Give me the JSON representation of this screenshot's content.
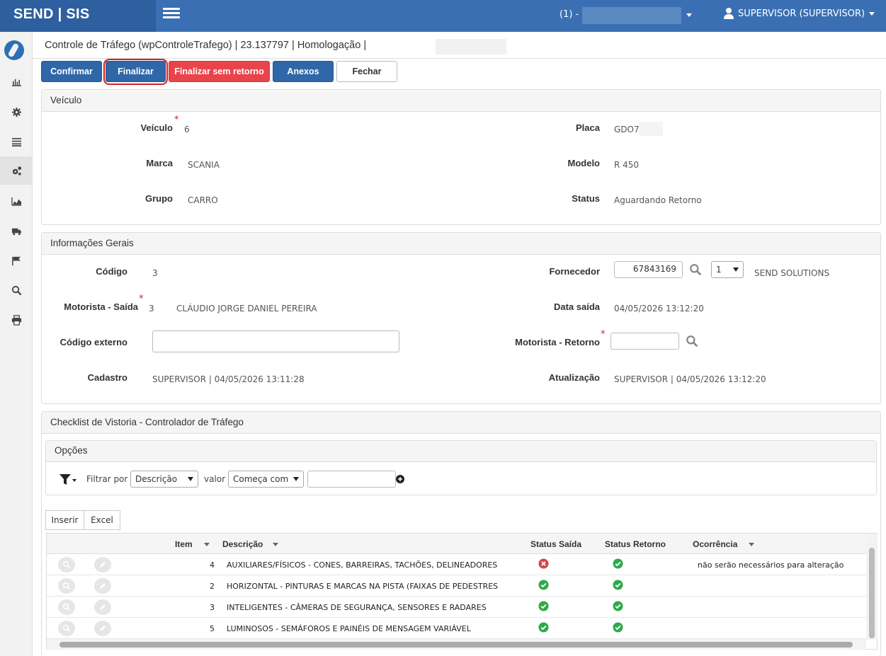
{
  "app": {
    "brand": "SEND | SIS",
    "session": "(1) -",
    "user": "SUPERVISOR (SUPERVISOR)"
  },
  "page": {
    "title": "Controle de Tráfego (wpControleTrafego) | 23.137797 | Homologação |"
  },
  "toolbar": {
    "confirmar": "Confirmar",
    "finalizar": "Finalizar",
    "finalizar_sem_retorno": "Finalizar sem retorno",
    "anexos": "Anexos",
    "fechar": "Fechar"
  },
  "veiculo": {
    "heading": "Veículo",
    "veiculo_label": "Veículo",
    "veiculo_value": "6",
    "placa_label": "Placa",
    "placa_value": "GDO7",
    "marca_label": "Marca",
    "marca_value": "SCANIA",
    "modelo_label": "Modelo",
    "modelo_value": "R 450",
    "grupo_label": "Grupo",
    "grupo_value": "CARRO",
    "status_label": "Status",
    "status_value": "Aguardando Retorno"
  },
  "info": {
    "heading": "Informações Gerais",
    "codigo_label": "Código",
    "codigo_value": "3",
    "fornecedor_label": "Fornecedor",
    "fornecedor_value": "67843169",
    "fornecedor_select": "1",
    "fornecedor_name": "SEND SOLUTIONS",
    "motorista_saida_label": "Motorista - Saída",
    "motorista_saida_code": "3",
    "motorista_saida_name": "CLÁUDIO JORGE DANIEL PEREIRA",
    "data_saida_label": "Data saída",
    "data_saida_value": "04/05/2026 13:12:20",
    "codigo_externo_label": "Código externo",
    "codigo_externo_value": "",
    "motorista_retorno_label": "Motorista - Retorno",
    "motorista_retorno_value": "",
    "cadastro_label": "Cadastro",
    "cadastro_value": "SUPERVISOR | 04/05/2026 13:11:28",
    "atualizacao_label": "Atualização",
    "atualizacao_value": "SUPERVISOR | 04/05/2026 13:12:20"
  },
  "checklist": {
    "heading": "Checklist de Vistoria - Controlador de Tráfego",
    "options_heading": "Opções",
    "filtrar_por": "Filtrar por",
    "filter_field": "Descrição",
    "valor": "valor",
    "filter_op": "Começa com",
    "filter_value": "",
    "inserir": "Inserir",
    "excel": "Excel",
    "columns": {
      "item": "Item",
      "descricao": "Descrição",
      "status_saida": "Status Saída",
      "status_retorno": "Status Retorno",
      "ocorrencia": "Ocorrência"
    },
    "rows": [
      {
        "item": "4",
        "descricao": "AUXILIARES/FÍSICOS - CONES, BARREIRAS, TACHÕES, DELINEADORES",
        "status_saida": "fail",
        "status_retorno": "ok",
        "ocorrencia": "não serão necessários para alteração"
      },
      {
        "item": "2",
        "descricao": "HORIZONTAL - PINTURAS E MARCAS NA PISTA (FAIXAS DE PEDESTRES",
        "status_saida": "ok",
        "status_retorno": "ok",
        "ocorrencia": ""
      },
      {
        "item": "3",
        "descricao": "INTELIGENTES - CÂMERAS DE SEGURANÇA, SENSORES E RADARES",
        "status_saida": "ok",
        "status_retorno": "ok",
        "ocorrencia": ""
      },
      {
        "item": "5",
        "descricao": "LUMINOSOS - SEMÁFOROS E PAINÉIS DE MENSAGEM VARIÁVEL",
        "status_saida": "ok",
        "status_retorno": "ok",
        "ocorrencia": ""
      }
    ]
  },
  "colors": {
    "primary": "#2f67a8",
    "danger": "#e9434b",
    "ok": "#2eaa4a",
    "fail": "#d9434b"
  }
}
